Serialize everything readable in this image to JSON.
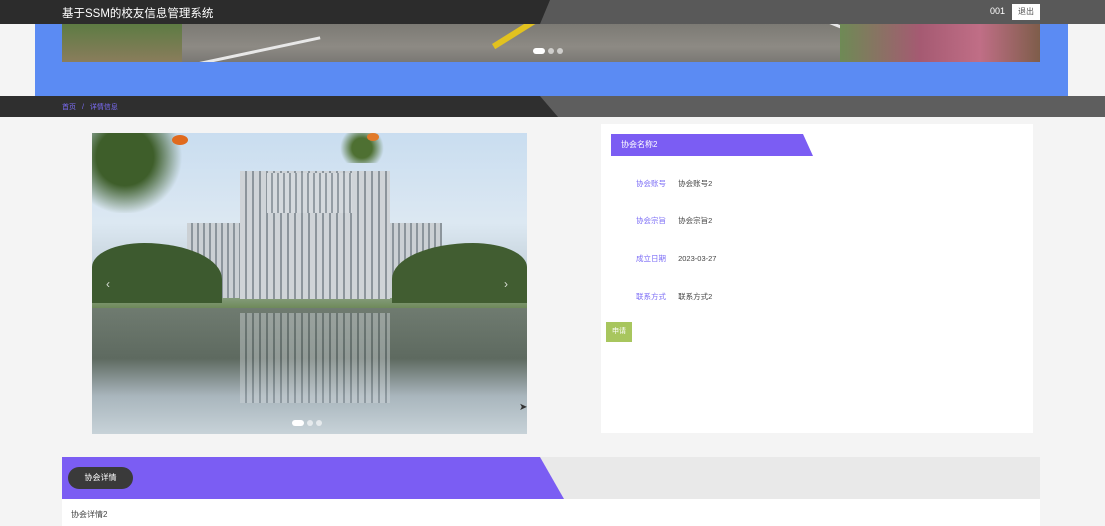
{
  "header": {
    "app_title": "基于SSM的校友信息管理系统",
    "username": "001",
    "logout_label": "退出"
  },
  "banner": {
    "slide_count": 3,
    "active_index": 0
  },
  "breadcrumb": {
    "home": "首页",
    "separator": "/",
    "current": "详情信息"
  },
  "carousel": {
    "slide_count": 3,
    "active_index": 0,
    "prev": "‹",
    "next": "›"
  },
  "info": {
    "title": "协会名称2",
    "fields": [
      {
        "label": "协会账号",
        "value": "协会账号2"
      },
      {
        "label": "协会宗旨",
        "value": "协会宗旨2"
      },
      {
        "label": "成立日期",
        "value": "2023-03-27"
      },
      {
        "label": "联系方式",
        "value": "联系方式2"
      }
    ],
    "apply_label": "申请"
  },
  "detail": {
    "tab_label": "协会详情",
    "content": "协会详情2"
  },
  "colors": {
    "accent_purple": "#7b5df3",
    "banner_blue": "#5b8bf3",
    "apply_green": "#a8c65e",
    "topbar_dark": "#2c2c2c"
  }
}
